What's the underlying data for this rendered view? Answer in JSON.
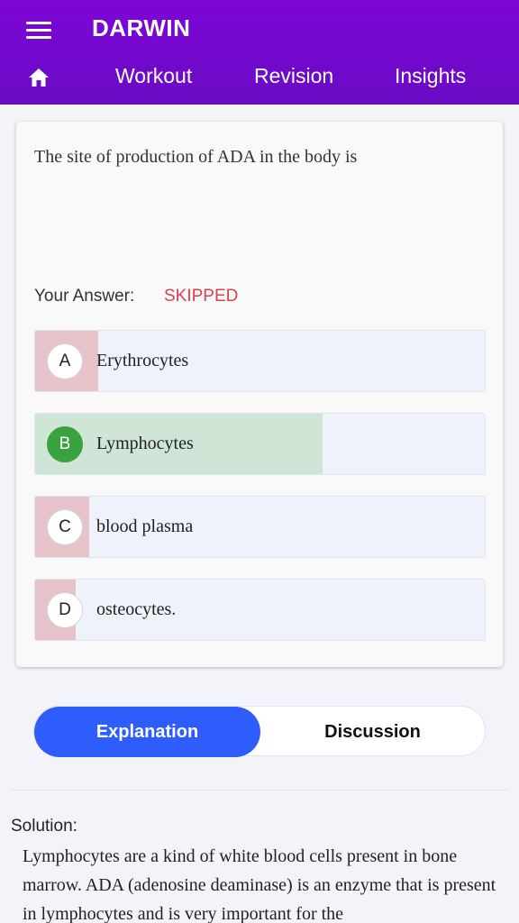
{
  "app": {
    "title": "DARWIN"
  },
  "nav": {
    "items": [
      "Workout",
      "Revision",
      "Insights"
    ]
  },
  "question": {
    "text": "The site of production of ADA in the body is"
  },
  "answer": {
    "label": "Your Answer:",
    "value": "SKIPPED"
  },
  "options": [
    {
      "letter": "A",
      "text": "Erythrocytes",
      "percent": 14,
      "correct": false
    },
    {
      "letter": "B",
      "text": "Lymphocytes",
      "percent": 64,
      "correct": true
    },
    {
      "letter": "C",
      "text": "blood plasma",
      "percent": 12,
      "correct": false
    },
    {
      "letter": "D",
      "text": "osteocytes.",
      "percent": 9,
      "correct": false
    }
  ],
  "tabs": {
    "explanation": "Explanation",
    "discussion": "Discussion"
  },
  "solution": {
    "label": "Solution:",
    "text": "Lymphocytes are a kind of white blood cells present in bone marrow. ADA (adenosine deaminase) is an enzyme that is present in lymphocytes and is very important for the"
  },
  "colors": {
    "header": "#7d06d6",
    "accent": "#2f5dfb",
    "skipped": "#d8414e",
    "correct": "#3aa23e"
  }
}
